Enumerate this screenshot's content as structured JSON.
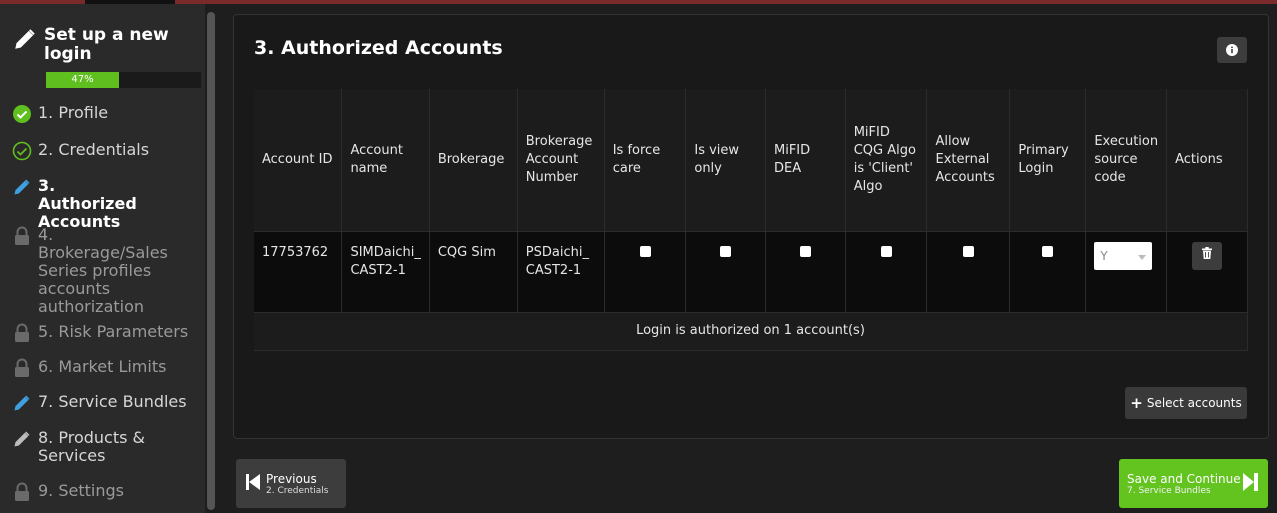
{
  "wizard": {
    "title": "Set up a new login",
    "progress_label": "47%",
    "progress": 0.47,
    "steps": [
      {
        "label": "1. Profile",
        "state": "done",
        "icon": "check-circle-filled-icon"
      },
      {
        "label": "2. Credentials",
        "state": "done",
        "icon": "check-circle-outline-icon"
      },
      {
        "label": "3. Authorized Accounts",
        "state": "active",
        "icon": "pencil-icon"
      },
      {
        "label": "4. Brokerage/Sales Series profiles accounts authorization",
        "state": "locked",
        "icon": "lock-icon"
      },
      {
        "label": "5. Risk Parameters",
        "state": "locked",
        "icon": "lock-icon"
      },
      {
        "label": "6. Market Limits",
        "state": "locked",
        "icon": "lock-icon"
      },
      {
        "label": "7. Service Bundles",
        "state": "editable",
        "icon": "pencil-icon"
      },
      {
        "label": "8. Products & Services",
        "state": "editable",
        "icon": "pencil-icon"
      },
      {
        "label": "9. Settings",
        "state": "locked",
        "icon": "lock-icon"
      }
    ]
  },
  "section": {
    "title": "3. Authorized Accounts",
    "info_icon": "info-icon"
  },
  "table": {
    "headers": [
      "Account ID",
      "Account name",
      "Brokerage",
      "Brokerage Account Number",
      "Is force care",
      "Is view only",
      "MiFID DEA",
      "MiFID CQG Algo is 'Client' Algo",
      "Allow External Accounts",
      "Primary Login",
      "Execution source code",
      "Actions"
    ],
    "rows": [
      {
        "account_id": "17753762",
        "account_name": "SIMDaichi_ CAST2-1",
        "brokerage": "CQG Sim",
        "brokerage_account_number": "PSDaichi_ CAST2-1",
        "is_force_care": false,
        "is_view_only": false,
        "mifid_dea": false,
        "mifid_cqg_algo": false,
        "allow_external": false,
        "primary_login": false,
        "execution_source_code": "Y"
      }
    ],
    "footer": "Login is authorized on 1 account(s)"
  },
  "buttons": {
    "select_accounts": "Select accounts",
    "previous_label": "Previous",
    "previous_sub": "2. Credentials",
    "next_label": "Save and Continue",
    "next_sub": "7. Service Bundles"
  },
  "colors": {
    "accent_green": "#63c420",
    "active_blue": "#3ea0e0",
    "done_green": "#5fbf1e"
  }
}
